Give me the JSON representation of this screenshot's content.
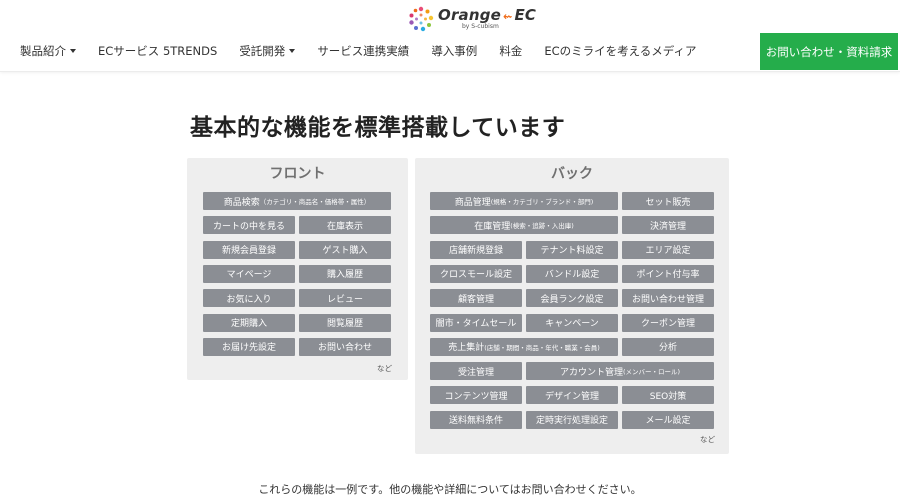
{
  "header": {
    "logo": {
      "main_a": "Orange",
      "main_b": "EC",
      "sub": "by S-cubism"
    },
    "nav": [
      {
        "label": "製品紹介",
        "has_caret": true
      },
      {
        "label": "ECサービス 5TRENDS",
        "has_caret": false
      },
      {
        "label": "受託開発",
        "has_caret": true
      },
      {
        "label": "サービス連携実績",
        "has_caret": false
      },
      {
        "label": "導入事例",
        "has_caret": false
      },
      {
        "label": "料金",
        "has_caret": false
      },
      {
        "label": "ECのミライを考えるメディア",
        "has_caret": false
      }
    ],
    "cta_label": "お問い合わせ・資料請求"
  },
  "main": {
    "title": "基本的な機能を標準搭載しています",
    "front": {
      "title": "フロント",
      "etc": "など",
      "chips": [
        {
          "label": "商品検索",
          "detail": "（カテゴリ・商品名・価格帯・属性）"
        },
        {
          "label": "カートの中を見る",
          "detail": ""
        },
        {
          "label": "在庫表示",
          "detail": ""
        },
        {
          "label": "新規会員登録",
          "detail": ""
        },
        {
          "label": "ゲスト購入",
          "detail": ""
        },
        {
          "label": "マイページ",
          "detail": ""
        },
        {
          "label": "購入履歴",
          "detail": ""
        },
        {
          "label": "お気に入り",
          "detail": ""
        },
        {
          "label": "レビュー",
          "detail": ""
        },
        {
          "label": "定期購入",
          "detail": ""
        },
        {
          "label": "閲覧履歴",
          "detail": ""
        },
        {
          "label": "お届け先設定",
          "detail": ""
        },
        {
          "label": "お問い合わせ",
          "detail": ""
        }
      ]
    },
    "back": {
      "title": "バック",
      "etc": "など",
      "chips": [
        {
          "label": "商品管理",
          "detail": "(規格・カテゴリ・ブランド・部門)"
        },
        {
          "label": "セット販売",
          "detail": ""
        },
        {
          "label": "在庫管理",
          "detail": "(検索・追跡・入出庫)"
        },
        {
          "label": "決済管理",
          "detail": ""
        },
        {
          "label": "店舗新規登録",
          "detail": ""
        },
        {
          "label": "テナント料設定",
          "detail": ""
        },
        {
          "label": "エリア設定",
          "detail": ""
        },
        {
          "label": "クロスモール設定",
          "detail": ""
        },
        {
          "label": "バンドル設定",
          "detail": ""
        },
        {
          "label": "ポイント付与率",
          "detail": ""
        },
        {
          "label": "顧客管理",
          "detail": ""
        },
        {
          "label": "会員ランク設定",
          "detail": ""
        },
        {
          "label": "お問い合わせ管理",
          "detail": ""
        },
        {
          "label": "闇市・タイムセール",
          "detail": ""
        },
        {
          "label": "キャンペーン",
          "detail": ""
        },
        {
          "label": "クーポン管理",
          "detail": ""
        },
        {
          "label": "売上集計",
          "detail": "(店舗・期間・商品・年代・職業・会員)"
        },
        {
          "label": "分析",
          "detail": ""
        },
        {
          "label": "受注管理",
          "detail": ""
        },
        {
          "label": "アカウント管理",
          "detail": "(メンバー・ロール)"
        },
        {
          "label": "コンテンツ管理",
          "detail": ""
        },
        {
          "label": "デザイン管理",
          "detail": ""
        },
        {
          "label": "SEO対策",
          "detail": ""
        },
        {
          "label": "送料無料条件",
          "detail": ""
        },
        {
          "label": "定時実行処理設定",
          "detail": ""
        },
        {
          "label": "メール設定",
          "detail": ""
        }
      ]
    },
    "footnote": "これらの機能は一例です。他の機能や詳細についてはお問い合わせください。"
  },
  "colors": {
    "cta": "#25ad4b",
    "chip": "#8b8e94",
    "panel": "#eeeeee",
    "logo_accent": "#ef6c1a"
  }
}
